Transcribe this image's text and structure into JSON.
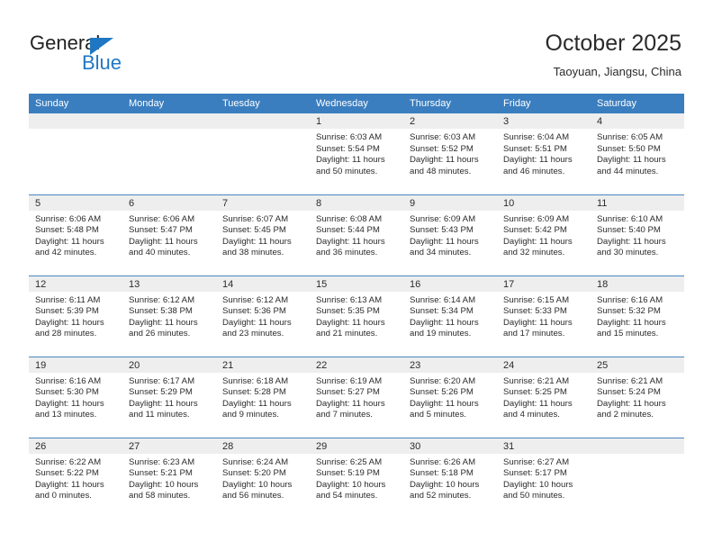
{
  "brand": {
    "name_top": "General",
    "name_bottom": "Blue",
    "triangle_color": "#1f77c4",
    "top_color": "#222222"
  },
  "header": {
    "title": "October 2025",
    "subtitle": "Taoyuan, Jiangsu, China"
  },
  "theme": {
    "header_bg": "#3a7ebf",
    "header_text": "#ffffff",
    "daynum_bg": "#eeeeee",
    "cell_bg": "#ffffff",
    "text": "#2b2b2b"
  },
  "columns": [
    "Sunday",
    "Monday",
    "Tuesday",
    "Wednesday",
    "Thursday",
    "Friday",
    "Saturday"
  ],
  "weeks": [
    [
      {
        "day": "",
        "info": ""
      },
      {
        "day": "",
        "info": ""
      },
      {
        "day": "",
        "info": ""
      },
      {
        "day": "1",
        "info": "Sunrise: 6:03 AM\nSunset: 5:54 PM\nDaylight: 11 hours\nand 50 minutes."
      },
      {
        "day": "2",
        "info": "Sunrise: 6:03 AM\nSunset: 5:52 PM\nDaylight: 11 hours\nand 48 minutes."
      },
      {
        "day": "3",
        "info": "Sunrise: 6:04 AM\nSunset: 5:51 PM\nDaylight: 11 hours\nand 46 minutes."
      },
      {
        "day": "4",
        "info": "Sunrise: 6:05 AM\nSunset: 5:50 PM\nDaylight: 11 hours\nand 44 minutes."
      }
    ],
    [
      {
        "day": "5",
        "info": "Sunrise: 6:06 AM\nSunset: 5:48 PM\nDaylight: 11 hours\nand 42 minutes."
      },
      {
        "day": "6",
        "info": "Sunrise: 6:06 AM\nSunset: 5:47 PM\nDaylight: 11 hours\nand 40 minutes."
      },
      {
        "day": "7",
        "info": "Sunrise: 6:07 AM\nSunset: 5:45 PM\nDaylight: 11 hours\nand 38 minutes."
      },
      {
        "day": "8",
        "info": "Sunrise: 6:08 AM\nSunset: 5:44 PM\nDaylight: 11 hours\nand 36 minutes."
      },
      {
        "day": "9",
        "info": "Sunrise: 6:09 AM\nSunset: 5:43 PM\nDaylight: 11 hours\nand 34 minutes."
      },
      {
        "day": "10",
        "info": "Sunrise: 6:09 AM\nSunset: 5:42 PM\nDaylight: 11 hours\nand 32 minutes."
      },
      {
        "day": "11",
        "info": "Sunrise: 6:10 AM\nSunset: 5:40 PM\nDaylight: 11 hours\nand 30 minutes."
      }
    ],
    [
      {
        "day": "12",
        "info": "Sunrise: 6:11 AM\nSunset: 5:39 PM\nDaylight: 11 hours\nand 28 minutes."
      },
      {
        "day": "13",
        "info": "Sunrise: 6:12 AM\nSunset: 5:38 PM\nDaylight: 11 hours\nand 26 minutes."
      },
      {
        "day": "14",
        "info": "Sunrise: 6:12 AM\nSunset: 5:36 PM\nDaylight: 11 hours\nand 23 minutes."
      },
      {
        "day": "15",
        "info": "Sunrise: 6:13 AM\nSunset: 5:35 PM\nDaylight: 11 hours\nand 21 minutes."
      },
      {
        "day": "16",
        "info": "Sunrise: 6:14 AM\nSunset: 5:34 PM\nDaylight: 11 hours\nand 19 minutes."
      },
      {
        "day": "17",
        "info": "Sunrise: 6:15 AM\nSunset: 5:33 PM\nDaylight: 11 hours\nand 17 minutes."
      },
      {
        "day": "18",
        "info": "Sunrise: 6:16 AM\nSunset: 5:32 PM\nDaylight: 11 hours\nand 15 minutes."
      }
    ],
    [
      {
        "day": "19",
        "info": "Sunrise: 6:16 AM\nSunset: 5:30 PM\nDaylight: 11 hours\nand 13 minutes."
      },
      {
        "day": "20",
        "info": "Sunrise: 6:17 AM\nSunset: 5:29 PM\nDaylight: 11 hours\nand 11 minutes."
      },
      {
        "day": "21",
        "info": "Sunrise: 6:18 AM\nSunset: 5:28 PM\nDaylight: 11 hours\nand 9 minutes."
      },
      {
        "day": "22",
        "info": "Sunrise: 6:19 AM\nSunset: 5:27 PM\nDaylight: 11 hours\nand 7 minutes."
      },
      {
        "day": "23",
        "info": "Sunrise: 6:20 AM\nSunset: 5:26 PM\nDaylight: 11 hours\nand 5 minutes."
      },
      {
        "day": "24",
        "info": "Sunrise: 6:21 AM\nSunset: 5:25 PM\nDaylight: 11 hours\nand 4 minutes."
      },
      {
        "day": "25",
        "info": "Sunrise: 6:21 AM\nSunset: 5:24 PM\nDaylight: 11 hours\nand 2 minutes."
      }
    ],
    [
      {
        "day": "26",
        "info": "Sunrise: 6:22 AM\nSunset: 5:22 PM\nDaylight: 11 hours\nand 0 minutes."
      },
      {
        "day": "27",
        "info": "Sunrise: 6:23 AM\nSunset: 5:21 PM\nDaylight: 10 hours\nand 58 minutes."
      },
      {
        "day": "28",
        "info": "Sunrise: 6:24 AM\nSunset: 5:20 PM\nDaylight: 10 hours\nand 56 minutes."
      },
      {
        "day": "29",
        "info": "Sunrise: 6:25 AM\nSunset: 5:19 PM\nDaylight: 10 hours\nand 54 minutes."
      },
      {
        "day": "30",
        "info": "Sunrise: 6:26 AM\nSunset: 5:18 PM\nDaylight: 10 hours\nand 52 minutes."
      },
      {
        "day": "31",
        "info": "Sunrise: 6:27 AM\nSunset: 5:17 PM\nDaylight: 10 hours\nand 50 minutes."
      },
      {
        "day": "",
        "info": ""
      }
    ]
  ]
}
